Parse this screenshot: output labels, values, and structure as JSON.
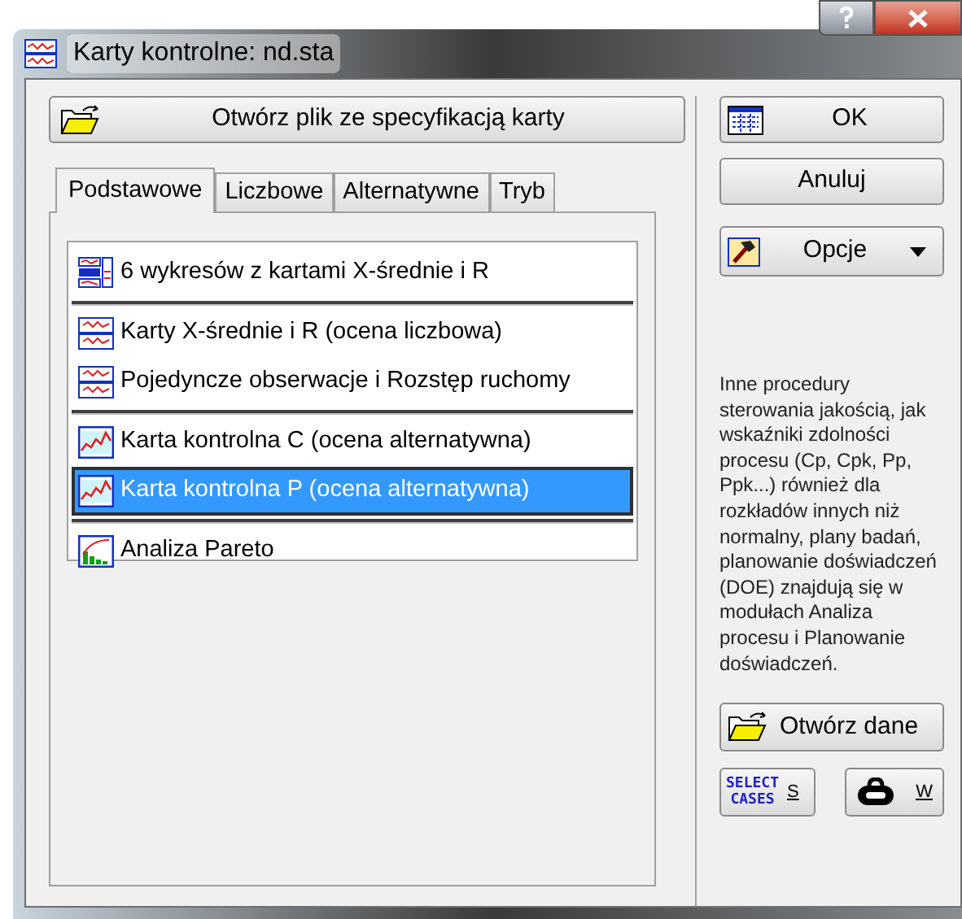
{
  "window": {
    "title": "Karty kontrolne: nd.sta"
  },
  "open_spec_button": "Otwórz plik ze specyfikacją karty",
  "tabs": [
    {
      "label": "Podstawowe",
      "selected": true
    },
    {
      "label": "Liczbowe",
      "selected": false
    },
    {
      "label": "Alternatywne",
      "selected": false
    },
    {
      "label": "Tryb",
      "selected": false
    }
  ],
  "list_groups": [
    [
      {
        "kind": "multi",
        "label": "6 wykresów z kartami X-średnie i R",
        "selected": false
      }
    ],
    [
      {
        "kind": "xr",
        "label": "Karty X-średnie i R (ocena liczbowa)",
        "selected": false
      },
      {
        "kind": "xr",
        "label": "Pojedyncze obserwacje i Rozstęp ruchomy",
        "selected": false
      }
    ],
    [
      {
        "kind": "attr",
        "label": "Karta kontrolna C (ocena alternatywna)",
        "selected": false
      },
      {
        "kind": "attr",
        "label": "Karta kontrolna P (ocena alternatywna)",
        "selected": true
      }
    ],
    [
      {
        "kind": "pareto",
        "label": "Analiza Pareto",
        "selected": false
      }
    ]
  ],
  "ok_button": "OK",
  "cancel_button": "Anuluj",
  "options_button": "Opcje",
  "info_text": "Inne procedury sterowania jakością, jak wskaźniki zdolności procesu (Cp, Cpk, Pp, Ppk...) również dla rozkładów innych niż normalny, plany badań, planowanie doświadczeń (DOE) znajdują się w modułach Analiza procesu i Planowanie doświadczeń.",
  "open_data_button": "Otwórz dane",
  "select_cases_button": {
    "icon_text": [
      "SELECT",
      "CASES"
    ],
    "label": "S"
  },
  "weight_button": {
    "label": "W"
  }
}
